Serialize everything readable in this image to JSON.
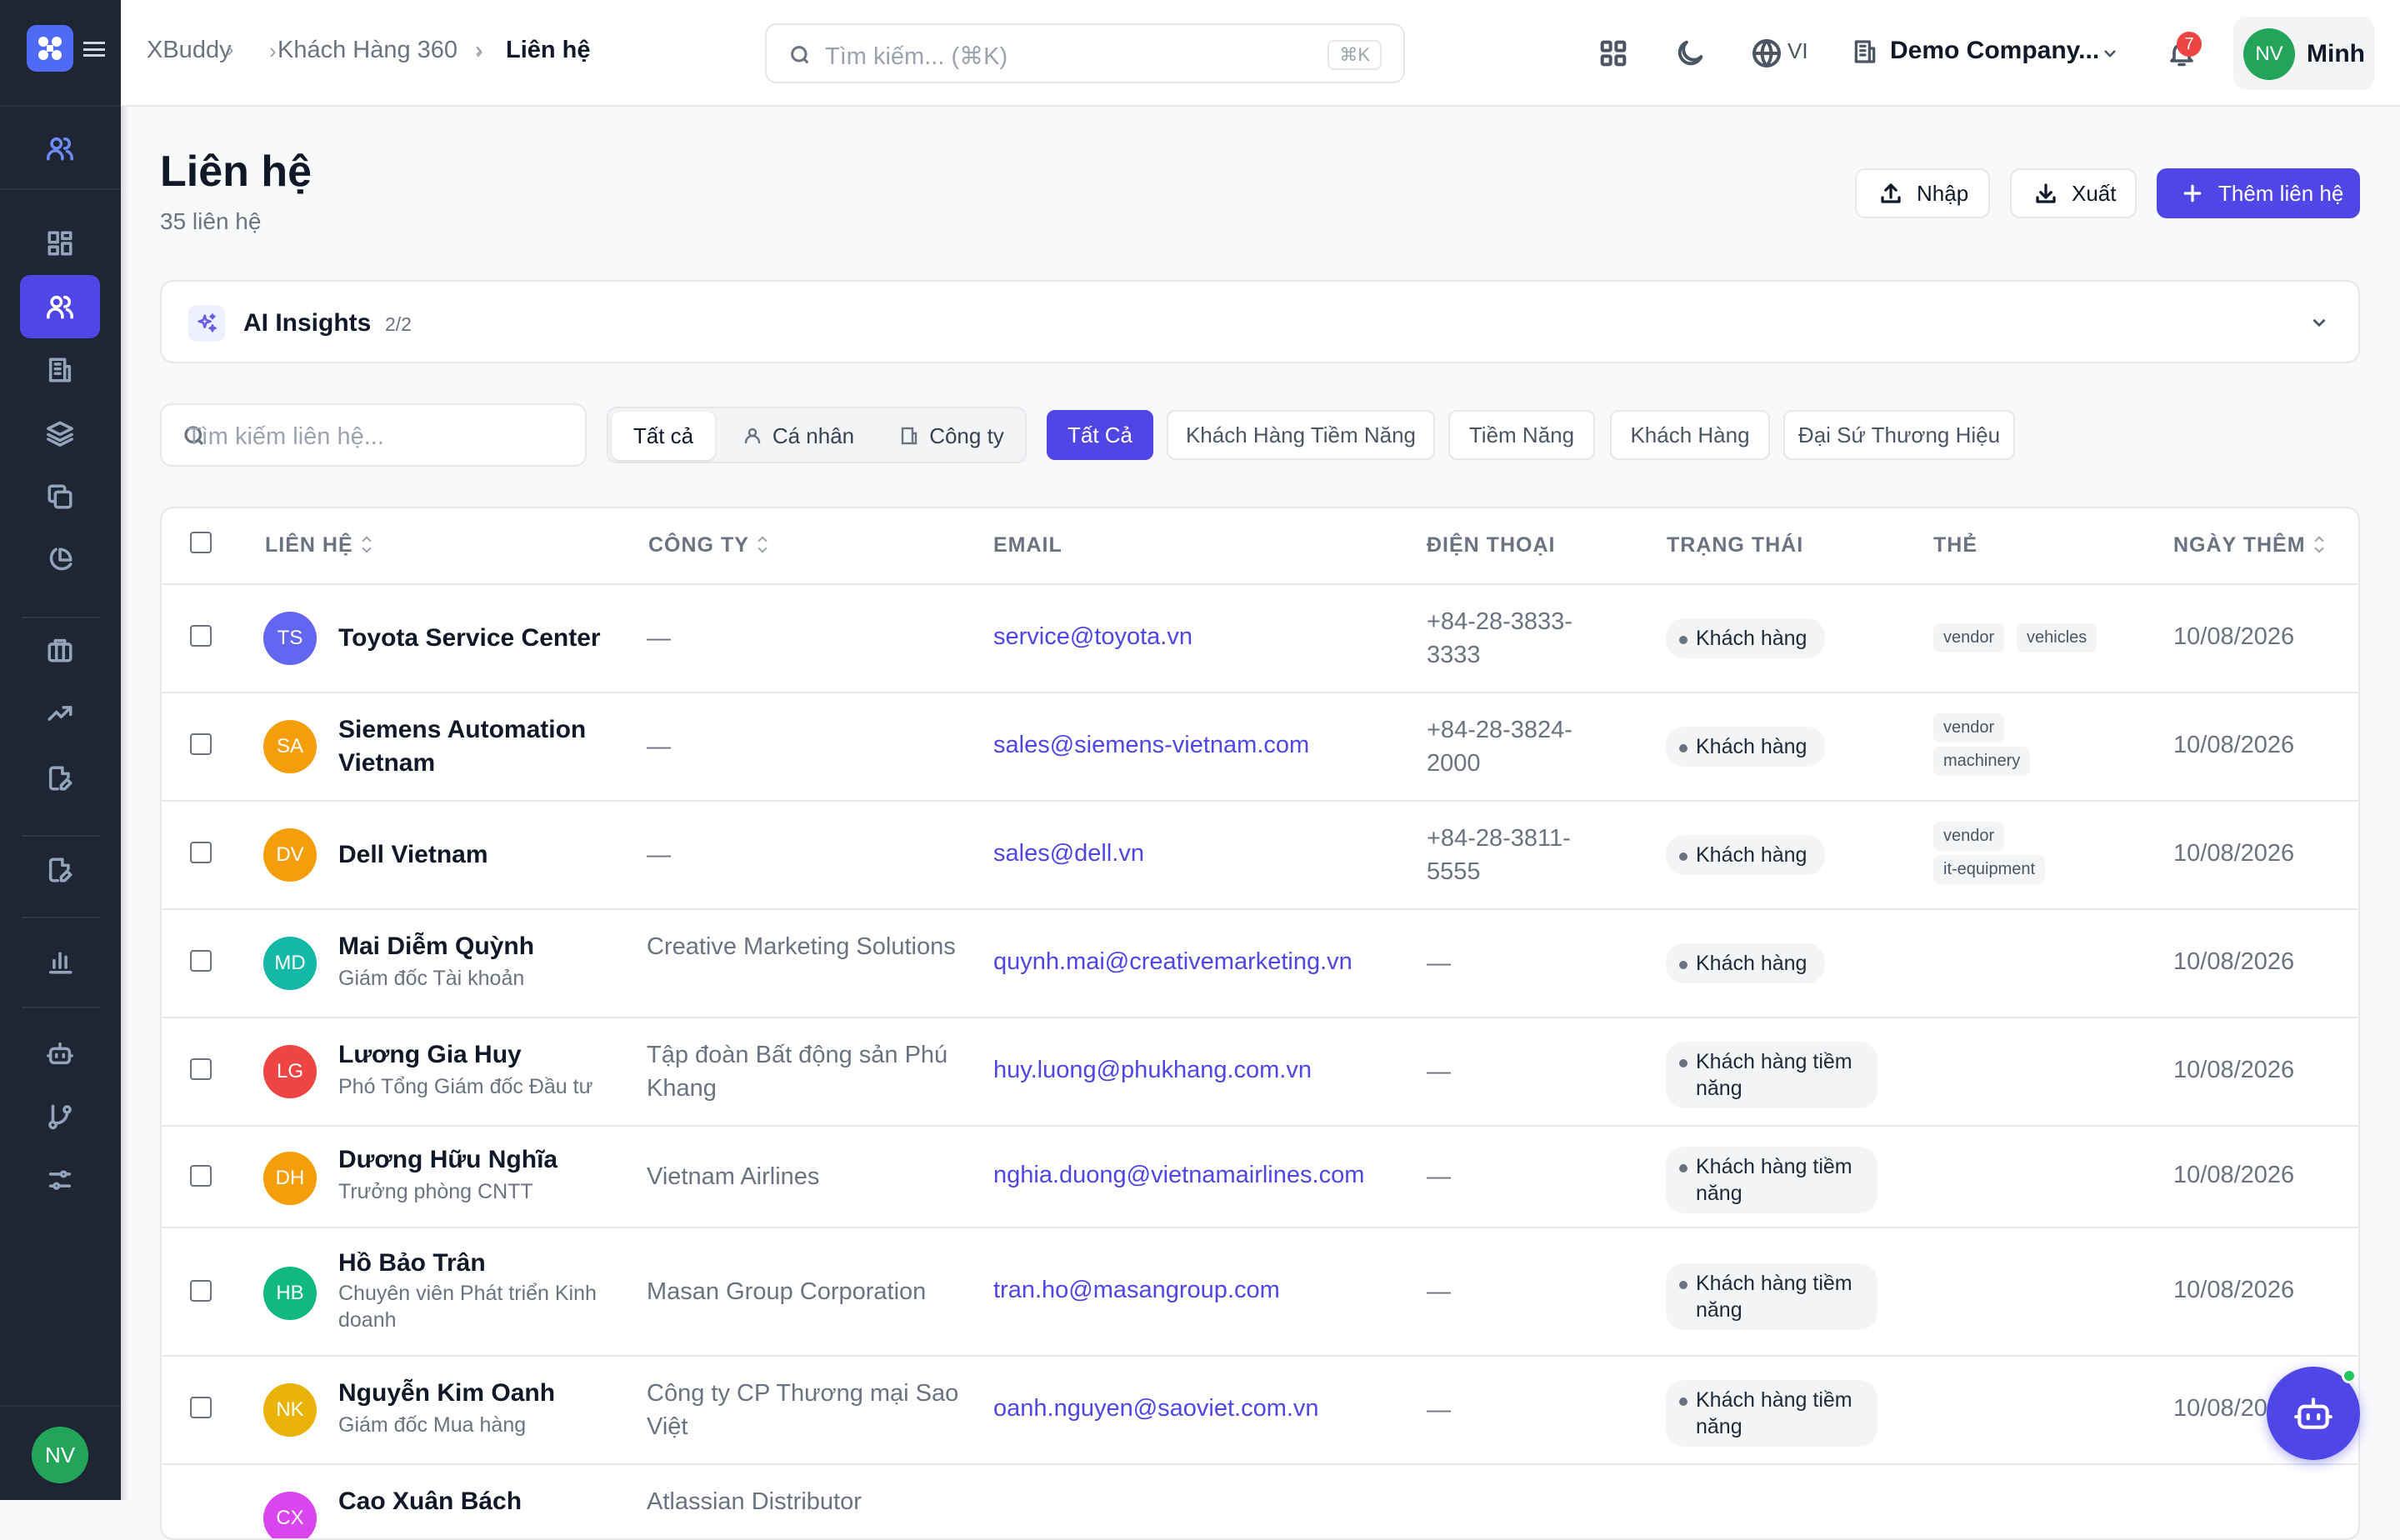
{
  "breadcrumb": [
    "XBuddy",
    "Khách Hàng 360",
    "Liên hệ"
  ],
  "search": {
    "placeholder": "Tìm kiếm... (⌘K)",
    "shortcut": "⌘K"
  },
  "header": {
    "lang": "VI",
    "company": "Demo Company...",
    "notifications": "7",
    "user_initials": "NV",
    "user_name": "Minh"
  },
  "page": {
    "title": "Liên hệ",
    "subtitle": "35 liên hệ"
  },
  "actions": {
    "import": "Nhập",
    "export": "Xuất",
    "add": "Thêm liên hệ"
  },
  "ai": {
    "title": "AI Insights",
    "count": "2/2"
  },
  "filter": {
    "search_placeholder": "Tìm kiếm liên hệ...",
    "segments": [
      "Tất cả",
      "Cá nhân",
      "Công ty"
    ],
    "chips": [
      "Tất Cả",
      "Khách Hàng Tiềm Năng",
      "Tiềm Năng",
      "Khách Hàng",
      "Đại Sứ Thương Hiệu"
    ]
  },
  "table": {
    "headers": [
      "LIÊN HỆ",
      "CÔNG TY",
      "EMAIL",
      "ĐIỆN THOẠI",
      "TRẠNG THÁI",
      "THẺ",
      "NGÀY THÊM"
    ],
    "rows": [
      {
        "initials": "TS",
        "color": "#6366f1",
        "name": "Toyota Service Center",
        "title": "",
        "company": "—",
        "email": "service@toyota.vn",
        "phone": "+84-28-3833-3333",
        "status": "Khách hàng",
        "tags": [
          "vendor",
          "vehicles"
        ],
        "date": "10/08/2026"
      },
      {
        "initials": "SA",
        "color": "#f59e0b",
        "name": "Siemens Automation Vietnam",
        "title": "",
        "company": "—",
        "email": "sales@siemens-vietnam.com",
        "phone": "+84-28-3824-2000",
        "status": "Khách hàng",
        "tags": [
          "vendor",
          "machinery"
        ],
        "date": "10/08/2026"
      },
      {
        "initials": "DV",
        "color": "#f59e0b",
        "name": "Dell Vietnam",
        "title": "",
        "company": "—",
        "email": "sales@dell.vn",
        "phone": "+84-28-3811-5555",
        "status": "Khách hàng",
        "tags": [
          "vendor",
          "it-equipment"
        ],
        "date": "10/08/2026"
      },
      {
        "initials": "MD",
        "color": "#14b8a6",
        "name": "Mai Diễm Quỳnh",
        "title": "Giám đốc Tài khoản",
        "company": "Creative Marketing Solutions",
        "email": "quynh.mai@creativemarketing.vn",
        "phone": "—",
        "status": "Khách hàng",
        "tags": [],
        "date": "10/08/2026"
      },
      {
        "initials": "LG",
        "color": "#ef4444",
        "name": "Lương Gia Huy",
        "title": "Phó Tổng Giám đốc Đầu tư",
        "company": "Tập đoàn Bất động sản Phú Khang",
        "email": "huy.luong@phukhang.com.vn",
        "phone": "—",
        "status": "Khách hàng tiềm năng",
        "tags": [],
        "date": "10/08/2026"
      },
      {
        "initials": "DH",
        "color": "#f59e0b",
        "name": "Dương Hữu Nghĩa",
        "title": "Trưởng phòng CNTT",
        "company": "Vietnam Airlines",
        "email": "nghia.duong@vietnamairlines.com",
        "phone": "—",
        "status": "Khách hàng tiềm năng",
        "tags": [],
        "date": "10/08/2026"
      },
      {
        "initials": "HB",
        "color": "#10b981",
        "name": "Hồ Bảo Trân",
        "title": "Chuyên viên Phát triển Kinh doanh",
        "company": "Masan Group Corporation",
        "email": "tran.ho@masangroup.com",
        "phone": "—",
        "status": "Khách hàng tiềm năng",
        "tags": [],
        "date": "10/08/2026"
      },
      {
        "initials": "NK",
        "color": "#eab308",
        "name": "Nguyễn Kim Oanh",
        "title": "Giám đốc Mua hàng",
        "company": "Công ty CP Thương mại Sao Việt",
        "email": "oanh.nguyen@saoviet.com.vn",
        "phone": "—",
        "status": "Khách hàng tiềm năng",
        "tags": [],
        "date": "10/08/20"
      },
      {
        "initials": "CX",
        "color": "#d946ef",
        "name": "Cao Xuân Bách",
        "title": "",
        "company": "Atlassian Distributor",
        "email": "",
        "phone": "",
        "status": "",
        "tags": [],
        "date": ""
      }
    ]
  },
  "sidebar": {
    "initials": "NV"
  }
}
